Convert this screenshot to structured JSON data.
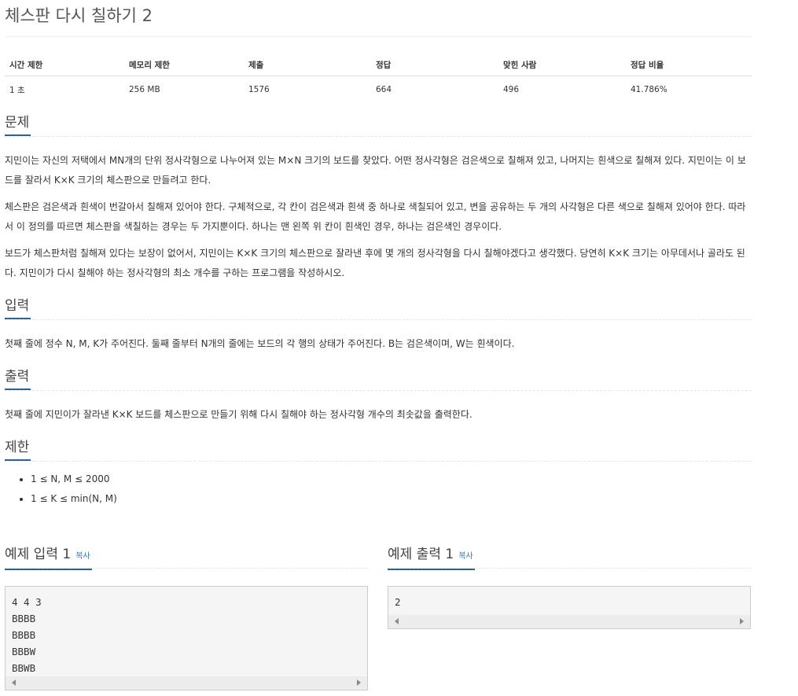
{
  "title": "체스판 다시 칠하기 2",
  "info_table": {
    "headers": [
      "시간 제한",
      "메모리 제한",
      "제출",
      "정답",
      "맞힌 사람",
      "정답 비율"
    ],
    "values": [
      "1 초",
      "256 MB",
      "1576",
      "664",
      "496",
      "41.786%"
    ]
  },
  "problem": {
    "heading": "문제",
    "paragraphs": [
      "지민이는 자신의 저택에서 MN개의 단위 정사각형으로 나누어져 있는 M×N 크기의 보드를 찾았다. 어떤 정사각형은 검은색으로 칠해져 있고, 나머지는 흰색으로 칠해져 있다. 지민이는 이 보드를 잘라서 K×K 크기의 체스판으로 만들려고 한다.",
      "체스판은 검은색과 흰색이 번갈아서 칠해져 있어야 한다. 구체적으로, 각 칸이 검은색과 흰색 중 하나로 색칠되어 있고, 변을 공유하는 두 개의 사각형은 다른 색으로 칠해져 있어야 한다. 따라서 이 정의를 따르면 체스판을 색칠하는 경우는 두 가지뿐이다. 하나는 맨 왼쪽 위 칸이 흰색인 경우, 하나는 검은색인 경우이다.",
      "보드가 체스판처럼 칠해져 있다는 보장이 없어서, 지민이는 K×K 크기의 체스판으로 잘라낸 후에 몇 개의 정사각형을 다시 칠해야겠다고 생각했다. 당연히 K×K 크기는 아무데서나 골라도 된다. 지민이가 다시 칠해야 하는 정사각형의 최소 개수를 구하는 프로그램을 작성하시오."
    ]
  },
  "input": {
    "heading": "입력",
    "text": "첫째 줄에 정수 N, M, K가 주어진다. 둘째 줄부터 N개의 줄에는 보드의 각 행의 상태가 주어진다. B는 검은색이며, W는 흰색이다."
  },
  "output": {
    "heading": "출력",
    "text": "첫째 줄에 지민이가 잘라낸 K×K 보드를 체스판으로 만들기 위해 다시 칠해야 하는 정사각형 개수의 최솟값을 출력한다."
  },
  "limits": {
    "heading": "제한",
    "items": [
      "1 ≤ N, M ≤ 2000",
      "1 ≤ K ≤ min(N, M)"
    ]
  },
  "sample_input": {
    "heading": "예제 입력 1",
    "copy_label": "복사",
    "lines": [
      "4 4 3",
      "BBBB",
      "BBBB",
      "BBBW",
      "BBWB"
    ]
  },
  "sample_output": {
    "heading": "예제 출력 1",
    "copy_label": "복사",
    "lines": [
      "2"
    ]
  },
  "colors": {
    "accent": "#2a6496",
    "link": "#337ab7",
    "code_bg": "#f5f5f5"
  }
}
